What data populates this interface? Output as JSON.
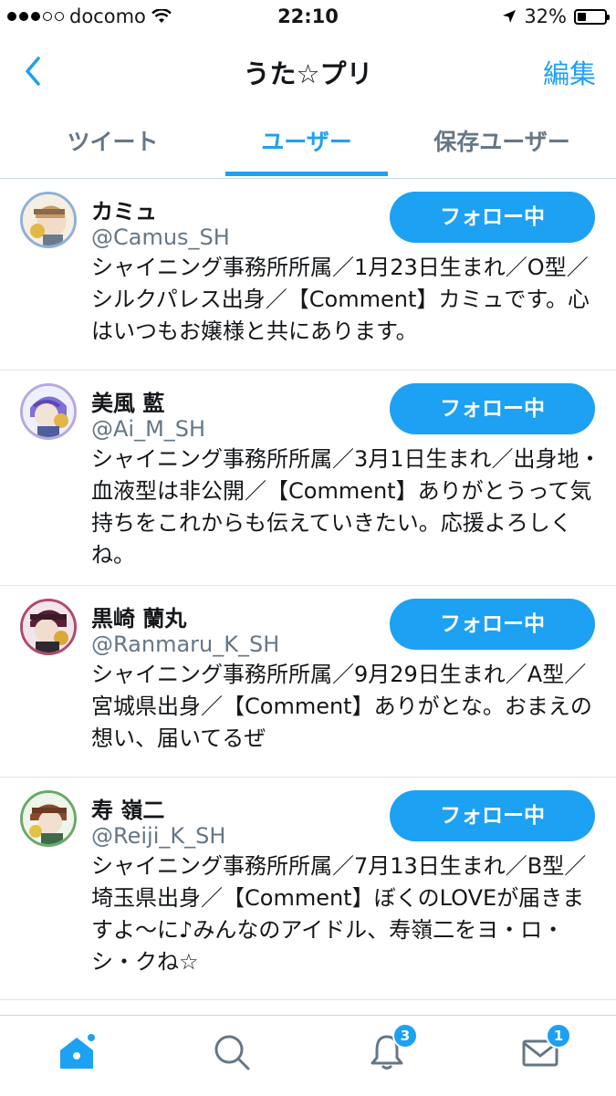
{
  "status_bar": {
    "carrier": "docomo",
    "time": "22:10",
    "battery": "32%"
  },
  "nav": {
    "title": "うた☆プリ",
    "edit_label": "編集"
  },
  "tabs": [
    {
      "label": "ツイート"
    },
    {
      "label": "ユーザー"
    },
    {
      "label": "保存ユーザー"
    }
  ],
  "users": [
    {
      "name": "カミュ",
      "handle": "@Camus_SH",
      "bio": "シャイニング事務所所属／1月23日生まれ／O型／シルクパレス出身／【Comment】カミュです。心はいつもお嬢様と共にあります。",
      "button": "フォロー中"
    },
    {
      "name": "美風 藍",
      "handle": "@Ai_M_SH",
      "bio": "シャイニング事務所所属／3月1日生まれ／出身地・血液型は非公開／【Comment】ありがとうって気持ちをこれからも伝えていきたい。応援よろしくね。",
      "button": "フォロー中"
    },
    {
      "name": "黒崎 蘭丸",
      "handle": "@Ranmaru_K_SH",
      "bio": "シャイニング事務所所属／9月29日生まれ／A型／宮城県出身／【Comment】ありがとな。おまえの想い、届いてるぜ",
      "button": "フォロー中"
    },
    {
      "name": "寿 嶺二",
      "handle": "@Reiji_K_SH",
      "bio": "シャイニング事務所所属／7月13日生まれ／B型／埼玉県出身／【Comment】ぼくのLOVEが届きますよ～に♪みんなのアイドル、寿嶺二をヨ・ロ・シ・クね☆",
      "button": "フォロー中"
    }
  ],
  "tab_bar": {
    "notifications_badge": "3",
    "messages_badge": "1"
  },
  "colors": {
    "accent": "#1da1f2",
    "text": "#14171a",
    "secondary": "#657786"
  }
}
